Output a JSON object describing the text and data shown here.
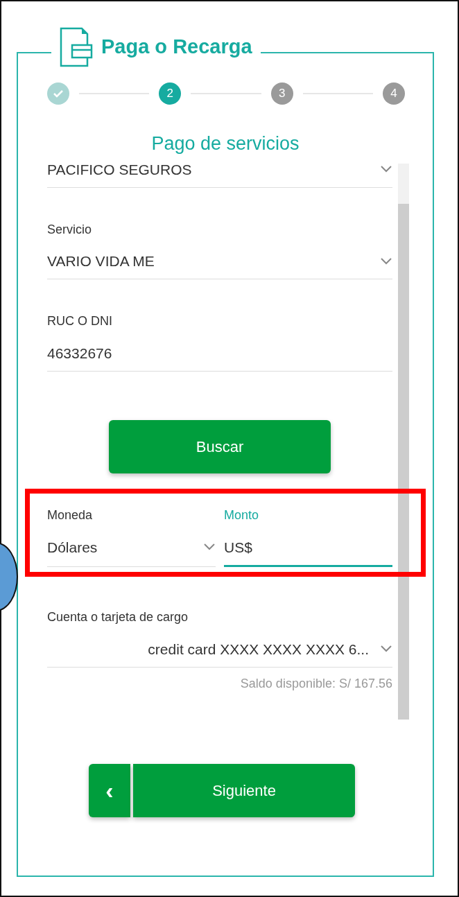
{
  "header": {
    "title": "Paga o Recarga"
  },
  "steps": [
    {
      "kind": "done"
    },
    {
      "label": "2",
      "kind": "current"
    },
    {
      "label": "3",
      "kind": "pending"
    },
    {
      "label": "4",
      "kind": "pending"
    }
  ],
  "section_title": "Pago de servicios",
  "fields": [
    {
      "kind": "select",
      "value": "PACIFICO SEGUROS"
    },
    {
      "kind": "select",
      "label": "Servicio",
      "value": "VARIO VIDA ME"
    },
    {
      "kind": "input",
      "label": "RUC O DNI",
      "value": "46332676"
    }
  ],
  "search_button": "Buscar",
  "amount_row": {
    "highlighted": true,
    "currency": {
      "label": "Moneda",
      "value": "Dólares"
    },
    "amount": {
      "label": "Monto",
      "value": "US$",
      "focused": true
    }
  },
  "account": {
    "label": "Cuenta o tarjeta de cargo",
    "value": "credit card XXXX XXXX XXXX 6...",
    "balance": "Saldo disponible: S/ 167.56"
  },
  "footer": {
    "back": "‹",
    "next": "Siguiente"
  },
  "marker": {
    "color": "#5b9bd5"
  }
}
